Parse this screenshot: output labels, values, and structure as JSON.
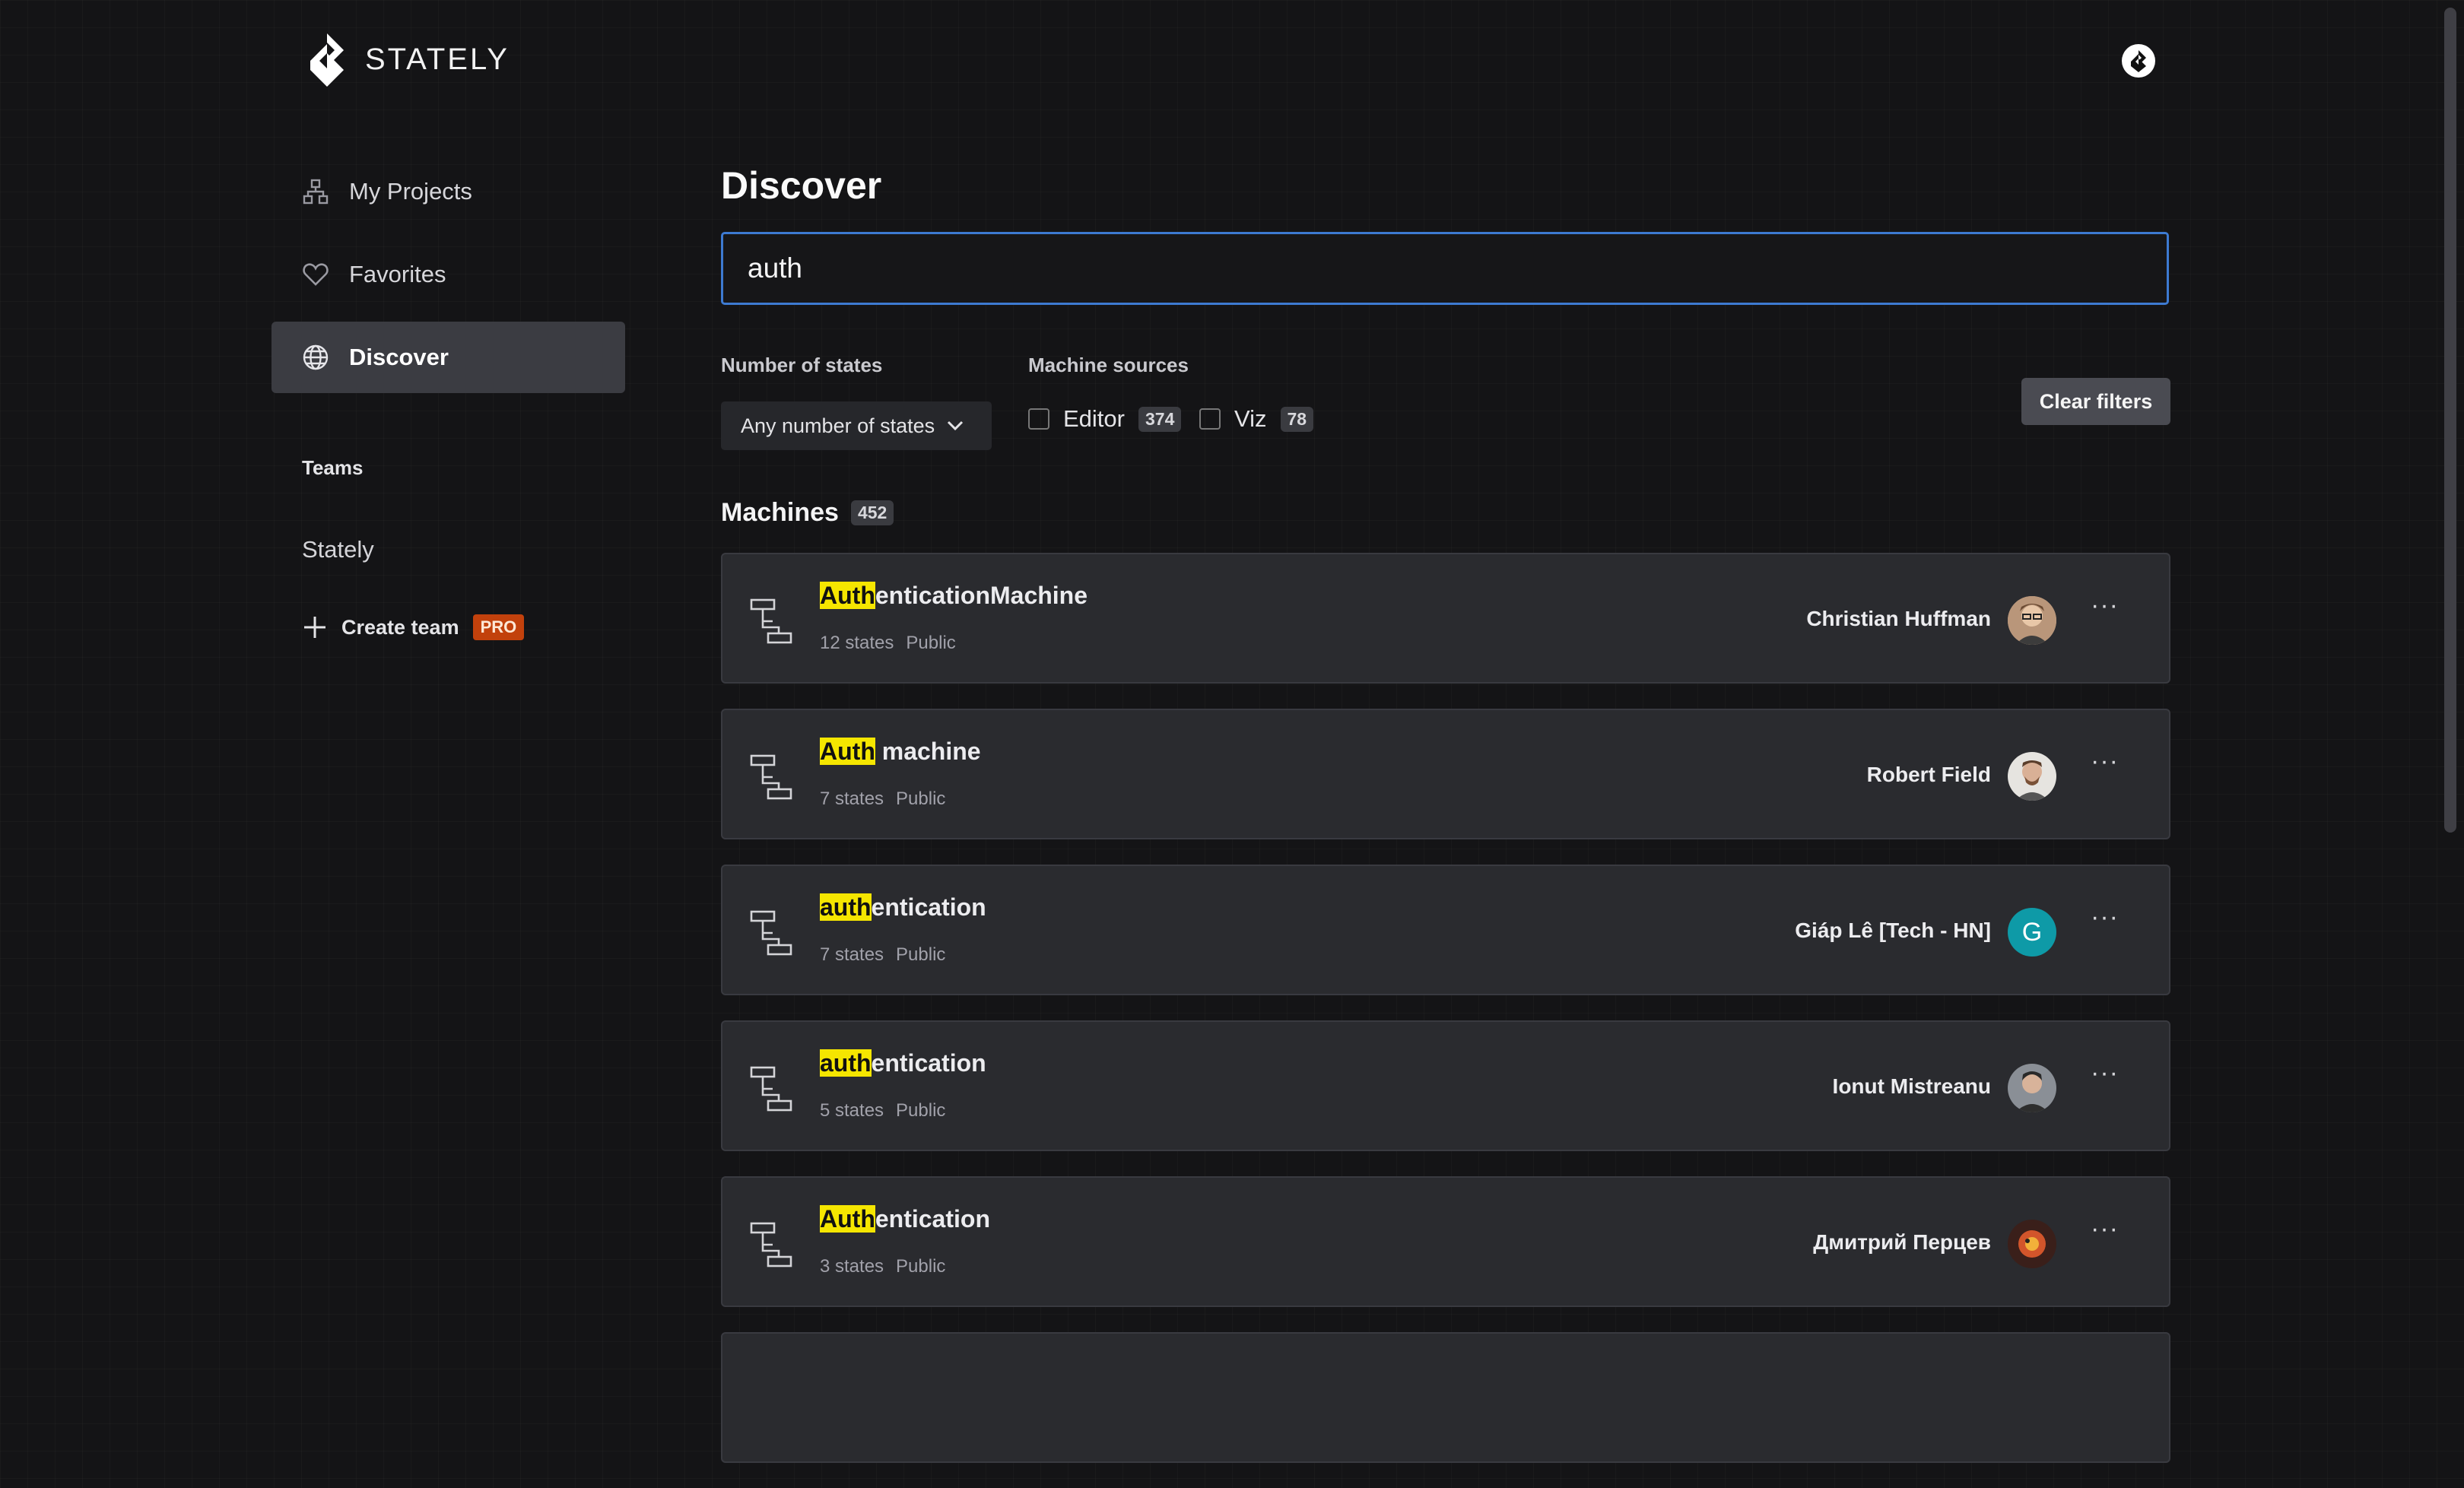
{
  "brand": {
    "name": "STATELY"
  },
  "nav": [
    {
      "label": "My Projects",
      "icon": "hierarchy-icon"
    },
    {
      "label": "Favorites",
      "icon": "heart-icon"
    },
    {
      "label": "Discover",
      "icon": "globe-icon",
      "active": true
    }
  ],
  "teams": {
    "heading": "Teams",
    "items": [
      "Stately"
    ],
    "create_label": "Create team",
    "pro_badge": "PRO"
  },
  "page": {
    "title": "Discover"
  },
  "search": {
    "value": "auth"
  },
  "filters": {
    "states_label": "Number of states",
    "states_select": "Any number of states",
    "sources_label": "Machine sources",
    "sources": [
      {
        "label": "Editor",
        "count": "374",
        "checked": false
      },
      {
        "label": "Viz",
        "count": "78",
        "checked": false
      }
    ],
    "clear_label": "Clear filters"
  },
  "machines": {
    "heading": "Machines",
    "count": "452",
    "items": [
      {
        "hl": "Auth",
        "rest": "enticationMachine",
        "states": "12 states",
        "visibility": "Public",
        "owner": "Christian Huffman",
        "avatar": "photo-avatar"
      },
      {
        "hl": "Auth",
        "rest": " machine",
        "states": "7 states",
        "visibility": "Public",
        "owner": "Robert Field",
        "avatar": "photo-avatar"
      },
      {
        "hl": "auth",
        "rest": "entication",
        "states": "7 states",
        "visibility": "Public",
        "owner": "Giáp Lê [Tech - HN]",
        "avatar_letter": "G"
      },
      {
        "hl": "auth",
        "rest": "entication",
        "states": "5 states",
        "visibility": "Public",
        "owner": "Ionut Mistreanu",
        "avatar": "photo-avatar"
      },
      {
        "hl": "Auth",
        "rest": "entication",
        "states": "3 states",
        "visibility": "Public",
        "owner": "Дмитрий Перцев",
        "avatar": "photo-avatar"
      }
    ],
    "more_label": "···"
  },
  "colors": {
    "accent": "#3d7ad1",
    "highlight": "#f5e600",
    "avatar_teal": "#0e9aa7",
    "pro": "#c2410c"
  }
}
